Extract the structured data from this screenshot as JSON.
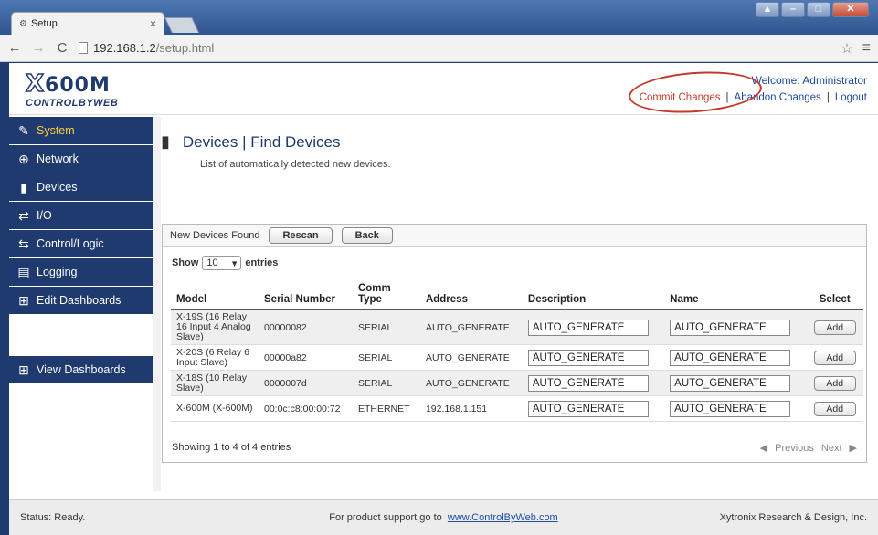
{
  "browser": {
    "tab_title": "Setup",
    "tab_close": "×",
    "url_host": "192.168.1.2",
    "url_path": "/setup.html"
  },
  "header": {
    "logo_brand_x": "X",
    "logo_brand_rest": "600M",
    "logo_sub": "CONTROLBYWEB",
    "welcome": "Welcome: Administrator",
    "commit": "Commit Changes",
    "abandon": "Abandon Changes",
    "logout": "Logout",
    "separator": "|"
  },
  "sidebar": {
    "items": [
      {
        "label": "System",
        "icon": "wrench-icon"
      },
      {
        "label": "Network",
        "icon": "globe-icon"
      },
      {
        "label": "Devices",
        "icon": "device-icon"
      },
      {
        "label": "I/O",
        "icon": "arrows-icon"
      },
      {
        "label": "Control/Logic",
        "icon": "logic-icon"
      },
      {
        "label": "Logging",
        "icon": "log-icon"
      },
      {
        "label": "Edit Dashboards",
        "icon": "dashboard-icon"
      }
    ],
    "view_dashboards": "View Dashboards"
  },
  "main": {
    "title": "Devices | Find Devices",
    "subtitle": "List of automatically detected new devices.",
    "panel_label": "New Devices Found",
    "rescan": "Rescan",
    "back": "Back",
    "show": "Show",
    "entries_value": "10",
    "entries": "entries",
    "columns": [
      "Model",
      "Serial Number",
      "Comm Type",
      "Address",
      "Description",
      "Name",
      "Select"
    ],
    "rows": [
      {
        "model": "X-19S (16 Relay 16 Input 4 Analog Slave)",
        "serial": "00000082",
        "comm": "SERIAL",
        "address": "AUTO_GENERATE",
        "description": "AUTO_GENERATE",
        "name": "AUTO_GENERATE",
        "select": "Add"
      },
      {
        "model": "X-20S (6 Relay 6 Input Slave)",
        "serial": "00000a82",
        "comm": "SERIAL",
        "address": "AUTO_GENERATE",
        "description": "AUTO_GENERATE",
        "name": "AUTO_GENERATE",
        "select": "Add"
      },
      {
        "model": "X-18S (10 Relay Slave)",
        "serial": "0000007d",
        "comm": "SERIAL",
        "address": "AUTO_GENERATE",
        "description": "AUTO_GENERATE",
        "name": "AUTO_GENERATE",
        "select": "Add"
      },
      {
        "model": "X-600M (X-600M)",
        "serial": "00:0c:c8:00:00:72",
        "comm": "ETHERNET",
        "address": "192.168.1.151",
        "description": "AUTO_GENERATE",
        "name": "AUTO_GENERATE",
        "select": "Add"
      }
    ],
    "showing": "Showing 1 to 4 of 4 entries",
    "previous": "Previous",
    "next": "Next"
  },
  "status": {
    "left": "Status:  Ready.",
    "support_text": "For product support go to",
    "support_link": "www.ControlByWeb.com",
    "right": "Xytronix Research & Design, Inc."
  },
  "colors": {
    "nav_bg": "#1e3a6e",
    "active_nav_text": "#ffd33a",
    "highlight_oval": "#c0392b"
  }
}
